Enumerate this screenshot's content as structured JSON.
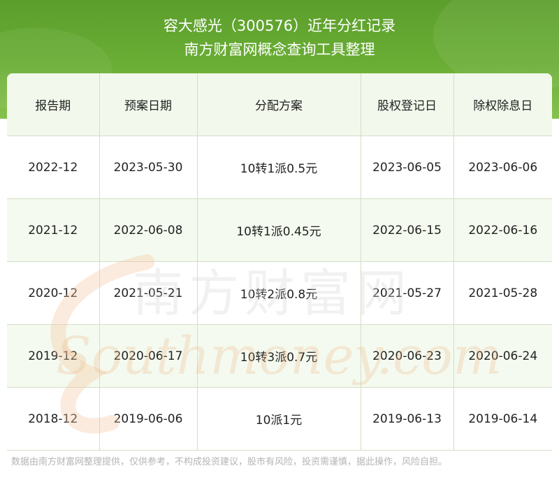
{
  "header": {
    "title_line1": "容大感光（300576）近年分红记录",
    "title_line2": "南方财富网概念查询工具整理"
  },
  "table": {
    "columns": [
      "报告期",
      "预案日期",
      "分配方案",
      "股权登记日",
      "除权除息日"
    ],
    "rows": [
      [
        "2022-12",
        "2023-05-30",
        "10转1派0.5元",
        "2023-06-05",
        "2023-06-06"
      ],
      [
        "2021-12",
        "2022-06-08",
        "10转1派0.45元",
        "2022-06-15",
        "2022-06-16"
      ],
      [
        "2020-12",
        "2021-05-21",
        "10转2派0.8元",
        "2021-05-27",
        "2021-05-28"
      ],
      [
        "2019-12",
        "2020-06-17",
        "10转3派0.7元",
        "2020-06-23",
        "2020-06-24"
      ],
      [
        "2018-12",
        "2019-06-06",
        "10派1元",
        "2019-06-13",
        "2019-06-14"
      ]
    ]
  },
  "watermark": {
    "cn_text": "南方财富网",
    "en_text": "Southmoney.com"
  },
  "disclaimer": "数据由南方财富网整理提供，仅供参考，不构成投资建议，股市有风险，投资需谨慎，据此操作，风险自担。",
  "colors": {
    "header_green": "#5b9e2c",
    "grid_line": "#d2dfc6",
    "row_tint": "#f2f9ec",
    "watermark_orange": "#f0b98a"
  }
}
